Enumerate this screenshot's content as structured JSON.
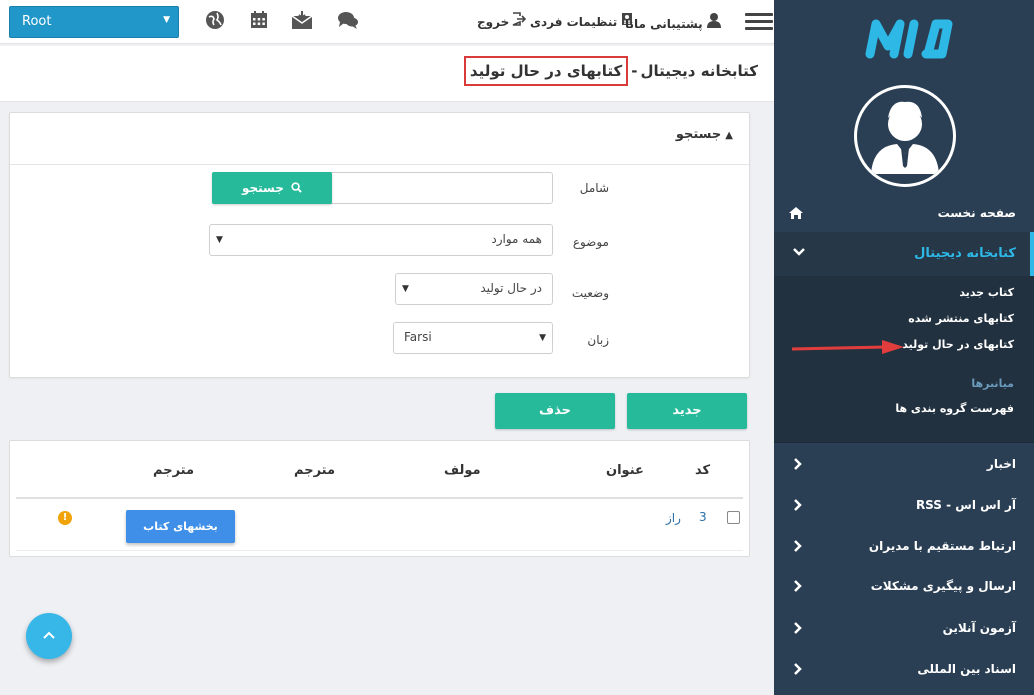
{
  "topbar": {
    "root_select": "Root",
    "support": "پشتیبانی مانا",
    "settings": "تنظیمات فردی",
    "logout": "خروج"
  },
  "breadcrumb": {
    "parent": "کتابخانه دیجیتال",
    "separator": "-",
    "current": "کتابهای در حال تولید"
  },
  "search_panel": {
    "title": "جستجو",
    "contains_label": "شامل",
    "contains_value": "",
    "search_button": "جستجو",
    "subject_label": "موضوع",
    "subject_value": "همه موارد",
    "status_label": "وضعیت",
    "status_value": "در حال تولید",
    "language_label": "زبان",
    "language_value": "Farsi"
  },
  "actions": {
    "new": "جدید",
    "delete": "حذف"
  },
  "table": {
    "headers": [
      "کد",
      "عنوان",
      "مولف",
      "مترجم",
      "مترجم"
    ],
    "rows": [
      {
        "code": "3",
        "title": "راز",
        "author": "",
        "translator": "",
        "sections_button": "بخشهای کتاب"
      }
    ]
  },
  "sidebar": {
    "logo": "مانا",
    "home": "صفحه نخست",
    "digital_library": "کتابخانه دیجیتال",
    "sub_items": [
      "کتاب جدید",
      "کتابهای منتشر شده",
      "کتابهای در حال تولید"
    ],
    "shortcuts_title": "میانبرها",
    "shortcut_item": "فهرست گروه بندی ها",
    "items": [
      "اخبار",
      "آر اس اس - RSS",
      "ارتباط مستقیم با مدیران",
      "ارسال و پیگیری مشکلات",
      "آزمون آنلاین",
      "اسناد بین المللی"
    ]
  },
  "colors": {
    "accent_green": "#26b99a",
    "sidebar_bg": "#2a3f54",
    "primary_blue": "#2196c9",
    "button_blue": "#3f8fe8",
    "highlight_red": "#d93b3b"
  }
}
